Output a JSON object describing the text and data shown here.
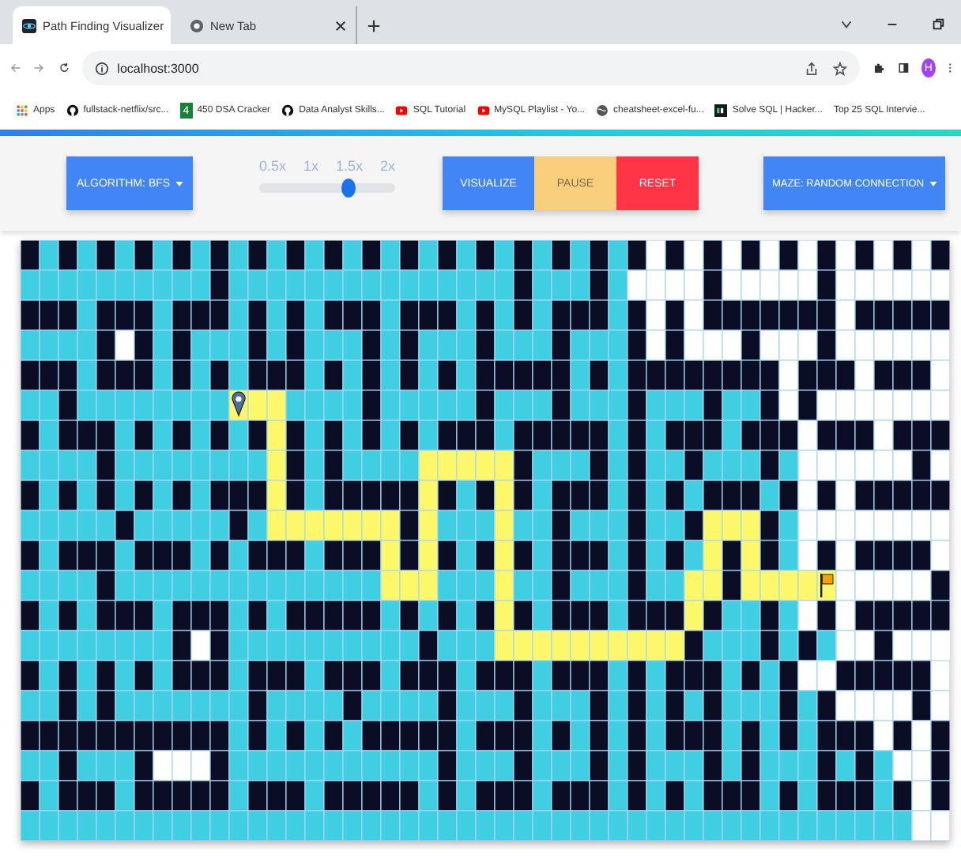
{
  "browser": {
    "tabs": [
      {
        "title": "Path Finding Visualizer",
        "selected": true
      },
      {
        "title": "New Tab",
        "selected": false
      }
    ],
    "address": "localhost:3000",
    "profile_initial": "H",
    "bookmarks": [
      {
        "kind": "apps",
        "label": "Apps"
      },
      {
        "kind": "github",
        "label": "fullstack-netflix/src..."
      },
      {
        "kind": "sheet",
        "badge": "4",
        "label": "450 DSA Cracker"
      },
      {
        "kind": "github",
        "label": "Data Analyst Skills..."
      },
      {
        "kind": "youtube",
        "label": "SQL Tutorial"
      },
      {
        "kind": "youtube",
        "label": "MySQL Playlist - Yo..."
      },
      {
        "kind": "globe",
        "label": "cheatsheet-excel-fu..."
      },
      {
        "kind": "terminal",
        "label": "Solve SQL | Hacker..."
      },
      {
        "kind": "blank",
        "label": "Top 25 SQL Intervie..."
      }
    ]
  },
  "toolbar": {
    "algorithm_button": "ALGORITHM: BFS",
    "speed": {
      "options": [
        "0.5x",
        "1x",
        "1.5x",
        "2x"
      ],
      "level": 0.66
    },
    "actions": [
      {
        "kind": "visualize",
        "label": "VISUALIZE"
      },
      {
        "kind": "pause",
        "label": "PAUSE"
      },
      {
        "kind": "reset",
        "label": "RESET"
      }
    ],
    "maze_button": "MAZE: RANDOM CONNECTION"
  }
}
